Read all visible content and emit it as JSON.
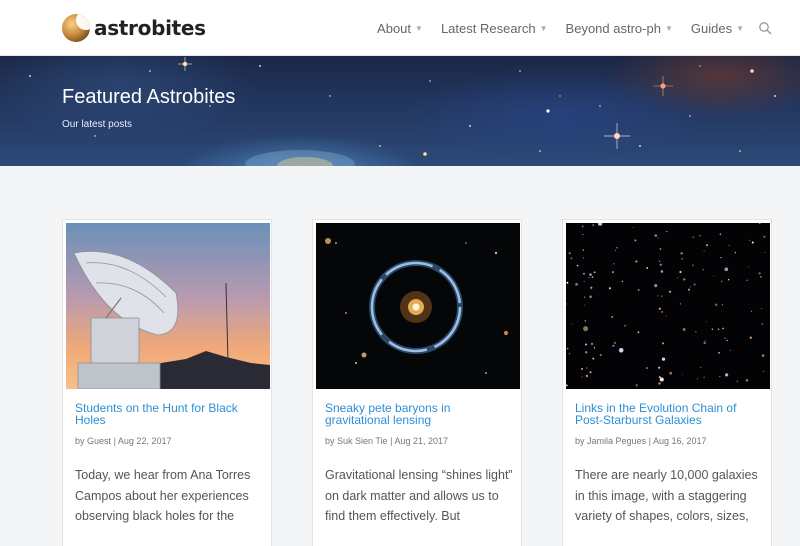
{
  "header": {
    "logo_text": "astrobites",
    "nav": [
      {
        "label": "About"
      },
      {
        "label": "Latest Research"
      },
      {
        "label": "Beyond astro-ph"
      },
      {
        "label": "Guides"
      }
    ],
    "icons": {
      "search": "search-icon",
      "caret": "chevron-down-icon"
    }
  },
  "hero": {
    "title": "Featured Astrobites",
    "subtitle": "Our latest posts"
  },
  "posts": [
    {
      "title": "Students on the Hunt for Black Holes",
      "by": "by",
      "author": "Guest",
      "separator": "|",
      "date": "Aug 22, 2017",
      "excerpt": "Today, we hear from Ana Torres Campos about her experiences observing black holes for the",
      "image": "radio-telescope-dish-at-sunset"
    },
    {
      "title": "Sneaky pete baryons in gravitational lensing",
      "by": "by",
      "author": "Suk Sien Tie",
      "separator": "|",
      "date": "Aug 21, 2017",
      "excerpt": "Gravitational lensing “shines light” on dark matter and allows us to find them effectively. But",
      "image": "einstein-ring-galaxy"
    },
    {
      "title": "Links in the Evolution Chain of Post-Starburst Galaxies",
      "by": "by",
      "author": "Jamila Pegues",
      "separator": "|",
      "date": "Aug 16, 2017",
      "excerpt": "There are nearly 10,000 galaxies in this image, with a staggering variety of shapes, colors, sizes,",
      "image": "deep-field-galaxies"
    }
  ],
  "colors": {
    "link": "#2e8fd6",
    "background": "#f4f5f6"
  }
}
